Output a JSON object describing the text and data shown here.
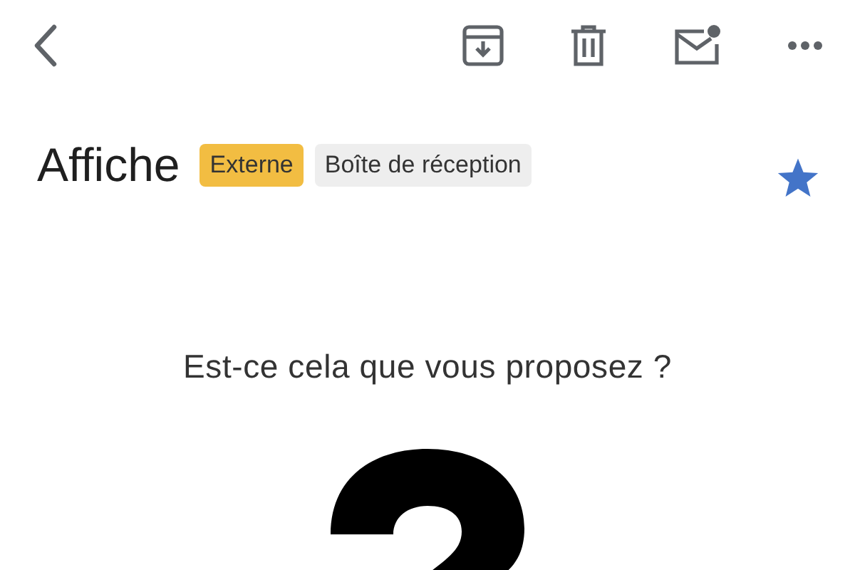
{
  "subject": "Affiche",
  "labels": [
    {
      "text": "Externe",
      "color": "#f2bd42"
    },
    {
      "text": "Boîte de réception",
      "color": "#eeeeee"
    }
  ],
  "starred": true,
  "body": {
    "text": "Est-ce cela que vous proposez ?"
  }
}
